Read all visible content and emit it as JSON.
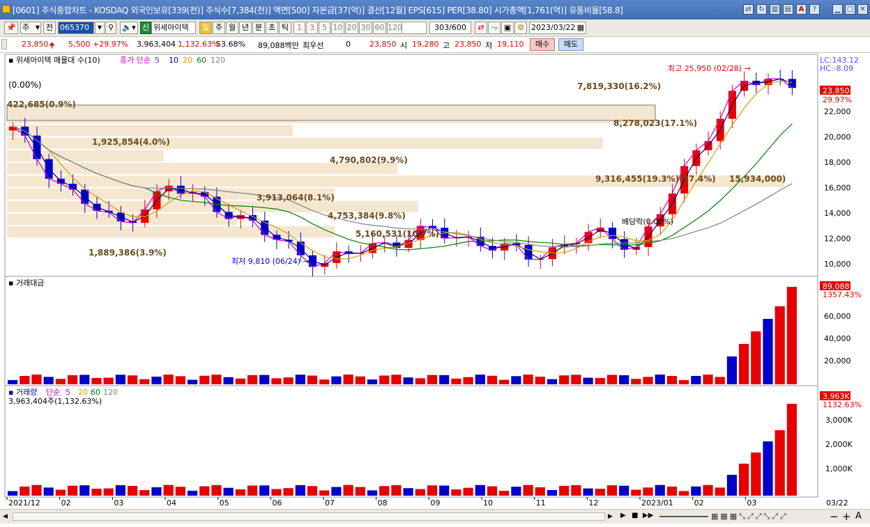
{
  "window": {
    "title": "[0601] 주식종합차트 - KOSDAQ 외국인보유[339(천)] 주식수[7,384(천)] 액면[500] 자본금[37(억)] 결산[12월] EPS[615] PER[38.80] 시가총액[1,761(억)] 유통비율[58.8]"
  },
  "toolbar": {
    "period_select": "주",
    "prev_label": "전",
    "code": "065370",
    "exchange_tag": "신",
    "stock_name": "위세아이텍",
    "period_tabs": [
      "일",
      "주",
      "월",
      "년",
      "분",
      "초",
      "틱"
    ],
    "minute_tabs": [
      "1",
      "3",
      "5",
      "10",
      "20",
      "30",
      "60",
      "120"
    ],
    "count_value": "303",
    "count_total": "/600",
    "date": "2023/03/22"
  },
  "quote": {
    "price": "23,850",
    "change": "5,500",
    "change_pct": "+29.97%",
    "volume": "3,963,404",
    "volume_pct": "1,132.63%",
    "ratio": "53.68%",
    "amount": "89,088백만",
    "priority_label": "최우선",
    "priority_value": "0",
    "best_price": "23,850",
    "open_label": "시",
    "open": "19,280",
    "high_label": "고",
    "high": "23,850",
    "low_label": "저",
    "low": "19,110",
    "buy_label": "매수",
    "sell_label": "매도"
  },
  "price_panel": {
    "legend_name": "위세아이텍 매물대 수(10)",
    "ma_label": "종가 단순",
    "ma_periods": [
      "5",
      "10",
      "20",
      "60",
      "120"
    ],
    "ma_colors": [
      "#cc00cc",
      "#000080",
      "#d4a000",
      "#008000",
      "#808080"
    ],
    "lc": "LC:143.12",
    "hc": "HC:-8.09",
    "current_price": "23,850",
    "current_pct": "29.97%",
    "y_labels": [
      "22,000",
      "20,000",
      "18,000",
      "16,000",
      "14,000",
      "12,000",
      "10,000"
    ],
    "high_annotation": "최고 25,950 (02/28)",
    "low_annotation": "최저 9,810 (06/24)",
    "dividend_annotation": "배당락(0.00%)",
    "top_left_label": "(0.00%)",
    "profile_labels": [
      "7,819,330(16.2%)",
      "422,685(0.9%)",
      "8,278,023(17.1%)",
      "1,925,854(4.0%)",
      "4,790,802(9.9%)",
      "9,316,455(19.3%)(17.4%)",
      "15,934,000)",
      "3,913,064(8.1%)",
      "4,753,384(9.8%)",
      "5,160,531(10.7%)",
      "1,889,386(3.9%)"
    ]
  },
  "amount_panel": {
    "title": "거래대금",
    "current": "89,088",
    "current_pct": "1357.43%",
    "y_labels": [
      "60,000",
      "40,000",
      "20,000"
    ]
  },
  "volume_panel": {
    "title": "거래량",
    "ma_label": "단순",
    "ma_periods": [
      "5",
      "20",
      "60",
      "120"
    ],
    "current_text": "3,963,404주(1,132.63%)",
    "current": "3,963K",
    "current_pct": "1132.63%",
    "y_labels": [
      "3,000K",
      "2,000K",
      "1,000K"
    ]
  },
  "x_axis": [
    "2021/12",
    "02",
    "03",
    "04",
    "05",
    "06",
    "07",
    "08",
    "09",
    "10",
    "11",
    "12",
    "2023/01",
    "02",
    "03"
  ],
  "x_axis_right": "03/22",
  "colors": {
    "up": "#e60000",
    "down": "#0000cc",
    "profile": "#f5e6d0",
    "title": "#3f6fb4"
  },
  "chart_data": {
    "type": "candlestick",
    "title": "위세아이텍",
    "ylim": [
      9000,
      26500
    ],
    "weekly_close_approx": [
      {
        "period": "2021/12",
        "value": 20500
      },
      {
        "period": "2022/01",
        "value": 16000
      },
      {
        "period": "2022/02",
        "value": 13000
      },
      {
        "period": "2022/03",
        "value": 16000
      },
      {
        "period": "2022/04",
        "value": 14500
      },
      {
        "period": "2022/05",
        "value": 12000
      },
      {
        "period": "2022/06",
        "value": 10000
      },
      {
        "period": "2022/07",
        "value": 11500
      },
      {
        "period": "2022/08",
        "value": 12500
      },
      {
        "period": "2022/09",
        "value": 11800
      },
      {
        "period": "2022/10",
        "value": 10400
      },
      {
        "period": "2022/11",
        "value": 12400
      },
      {
        "period": "2022/12",
        "value": 11400
      },
      {
        "period": "2023/01",
        "value": 17500
      },
      {
        "period": "2023/02",
        "value": 24500
      },
      {
        "period": "2023/03",
        "value": 23850
      }
    ],
    "extremes": {
      "max": 25950,
      "max_date": "02/28",
      "min": 9810,
      "min_date": "06/24"
    }
  }
}
